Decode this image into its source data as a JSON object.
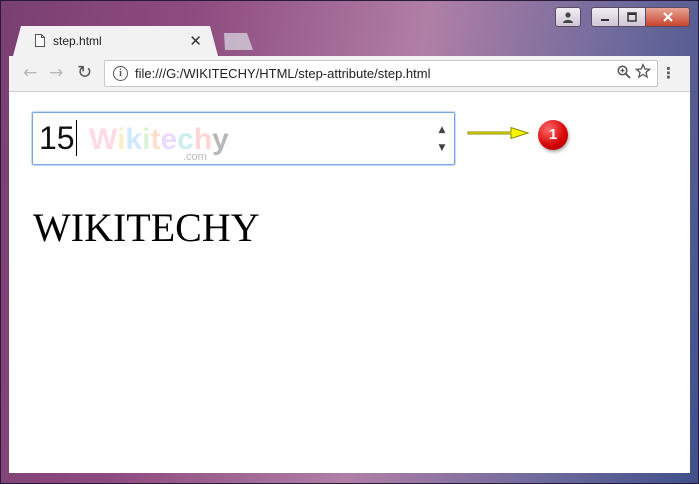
{
  "window": {
    "caption_icons": [
      "user-icon",
      "minimize-icon",
      "maximize-icon",
      "close-icon"
    ]
  },
  "tab": {
    "title": "step.html",
    "close_glyph": "✕",
    "icon": "document-icon"
  },
  "toolbar": {
    "back_glyph": "←",
    "forward_glyph": "→",
    "reload_glyph": "↻",
    "url": "file:///G:/WIKITECHY/HTML/step-attribute/step.html",
    "info_glyph": "i",
    "menu_glyph": "⋮"
  },
  "content": {
    "number_input_value": "15",
    "spin_up": "▲",
    "spin_down": "▼",
    "watermark_letters": [
      "W",
      "i",
      "k",
      "i",
      "t",
      "e",
      "c",
      "h",
      "y"
    ],
    "watermark_suffix": ".com",
    "annotation_marker": "1",
    "heading": "WIKITECHY"
  },
  "colors": {
    "input_focus_border": "#7aa6e6",
    "arrow": "#f5f500",
    "marker": "#d40000"
  }
}
